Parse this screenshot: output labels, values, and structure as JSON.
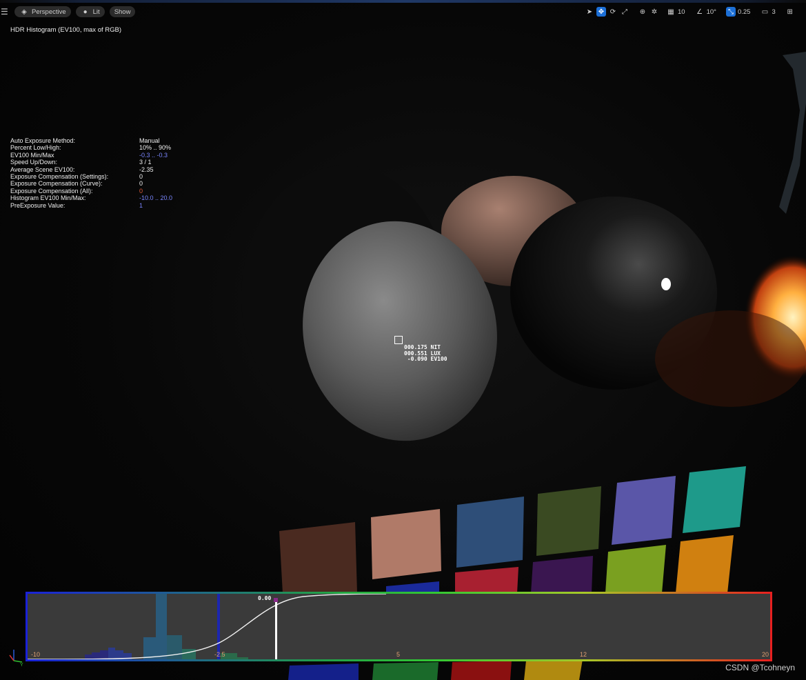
{
  "toolbar": {
    "view_mode": "Perspective",
    "lighting_mode": "Lit",
    "show_label": "Show",
    "grid_snap": "10",
    "rotation_snap": "10°",
    "scale_snap": "0.25",
    "camera_speed": "3"
  },
  "overlay": {
    "histogram_title": "HDR Histogram (EV100, max of RGB)",
    "stats": [
      {
        "label": "Auto Exposure Method:",
        "value": "Manual",
        "color": "#f0f0f0"
      },
      {
        "label": "Percent Low/High:",
        "value": "10% .. 90%",
        "color": "#f0f0f0"
      },
      {
        "label": "EV100 Min/Max",
        "value": "-0.3 .. -0.3",
        "color": "#7a86ff"
      },
      {
        "label": "Speed Up/Down:",
        "value": "3 / 1",
        "color": "#f0f0f0"
      },
      {
        "label": "Average Scene EV100:",
        "value": "-2.35",
        "color": "#f0f0f0"
      },
      {
        "label": "Exposure Compensation (Settings):",
        "value": "0",
        "color": "#f0f0f0"
      },
      {
        "label": "Exposure Compensation (Curve):",
        "value": "0",
        "color": "#f0f0f0"
      },
      {
        "label": "Exposure Compensation (All):",
        "value": "0",
        "color": "#e05a3a"
      },
      {
        "label": "Histogram EV100 Min/Max:",
        "value": "-10.0 .. 20.0",
        "color": "#7a86ff"
      },
      {
        "label": "PreExposure Value:",
        "value": "1",
        "color": "#7a86ff"
      }
    ]
  },
  "pixel_readout": {
    "nit": "000.175 NIT",
    "lux": "000.551 LUX",
    "ev100": " -0.090 EV100"
  },
  "histogram": {
    "current_value": "0.00",
    "ticks": [
      "-10",
      "-2.5",
      "5",
      "12",
      "20"
    ]
  },
  "watermark": "CSDN @Tcohneyn"
}
